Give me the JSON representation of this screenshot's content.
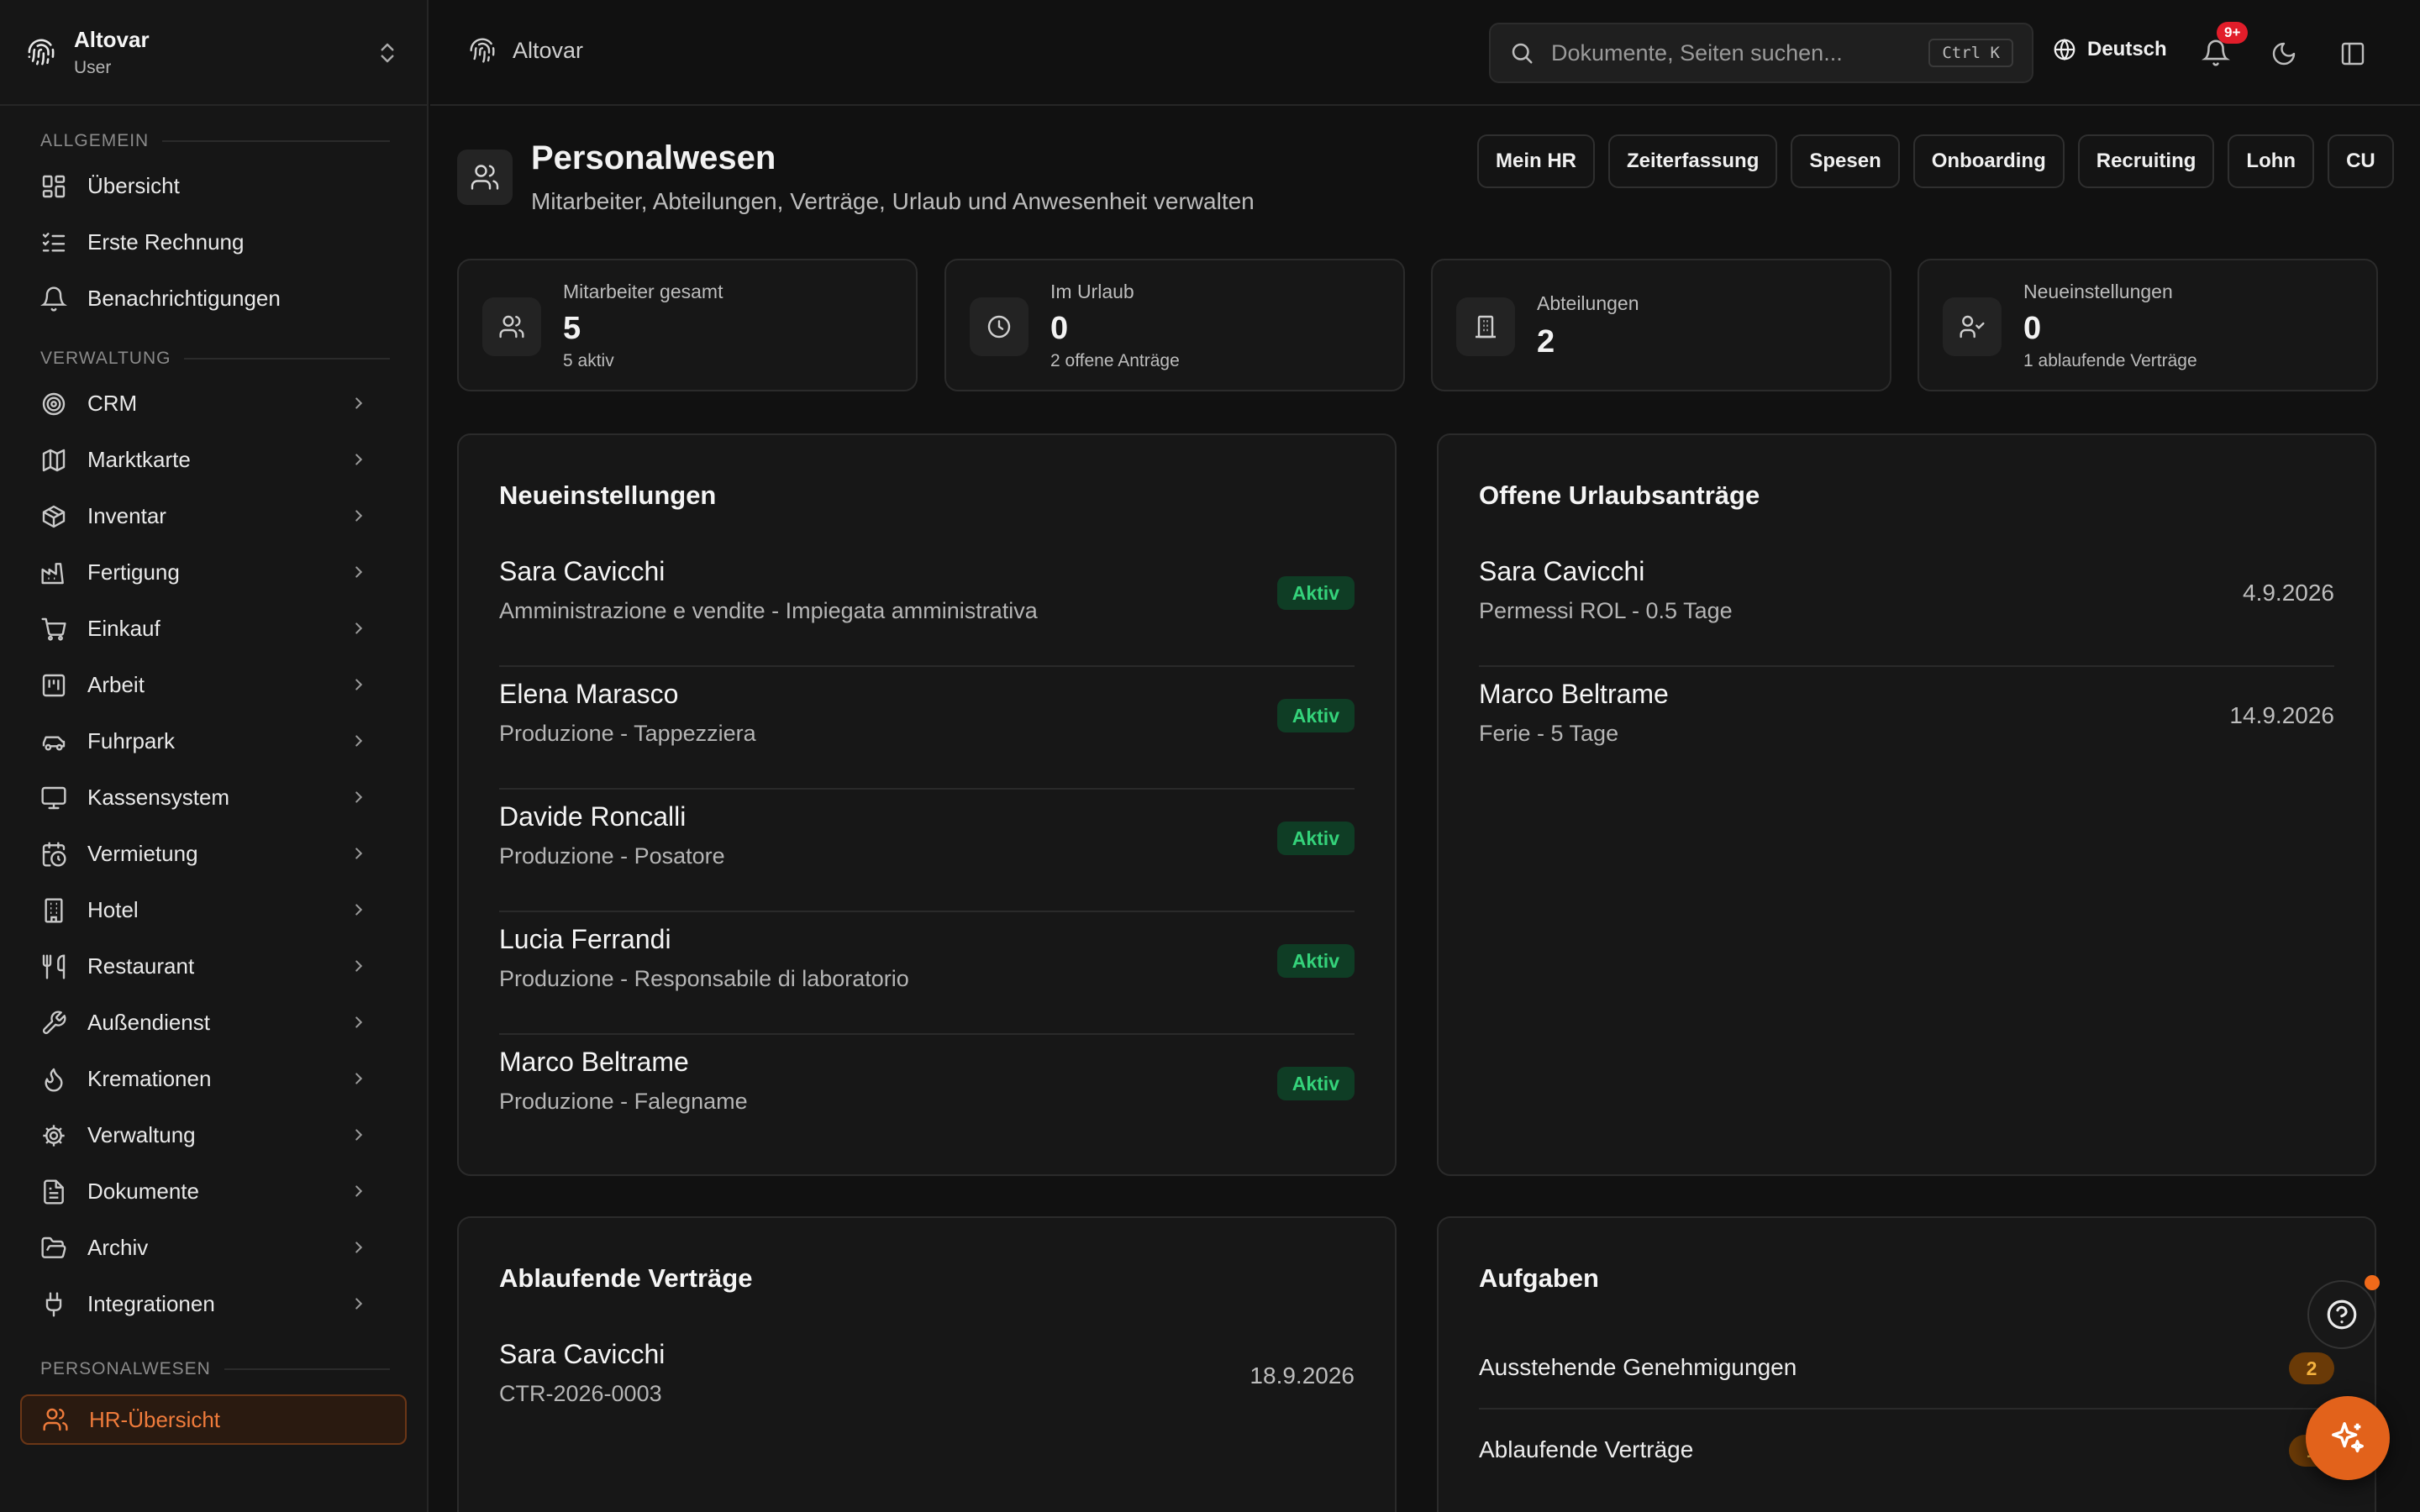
{
  "brand": {
    "name": "Altovar",
    "role": "User"
  },
  "sidebar": {
    "sections": {
      "general": "ALLGEMEIN",
      "admin": "VERWALTUNG",
      "hr": "PERSONALWESEN"
    },
    "general_items": [
      {
        "label": "Übersicht",
        "icon": "dashboard-icon"
      },
      {
        "label": "Erste Rechnung",
        "icon": "checklist-icon"
      },
      {
        "label": "Benachrichtigungen",
        "icon": "bell-icon"
      }
    ],
    "admin_items": [
      {
        "label": "CRM",
        "icon": "target-icon"
      },
      {
        "label": "Marktkarte",
        "icon": "map-icon"
      },
      {
        "label": "Inventar",
        "icon": "package-icon"
      },
      {
        "label": "Fertigung",
        "icon": "factory-icon"
      },
      {
        "label": "Einkauf",
        "icon": "cart-icon"
      },
      {
        "label": "Arbeit",
        "icon": "briefcase-icon"
      },
      {
        "label": "Fuhrpark",
        "icon": "car-icon"
      },
      {
        "label": "Kassensystem",
        "icon": "monitor-icon"
      },
      {
        "label": "Vermietung",
        "icon": "calendar-clock-icon"
      },
      {
        "label": "Hotel",
        "icon": "building-icon"
      },
      {
        "label": "Restaurant",
        "icon": "utensils-icon"
      },
      {
        "label": "Außendienst",
        "icon": "wrench-icon"
      },
      {
        "label": "Kremationen",
        "icon": "flame-icon"
      },
      {
        "label": "Verwaltung",
        "icon": "gear-icon"
      },
      {
        "label": "Dokumente",
        "icon": "file-icon"
      },
      {
        "label": "Archiv",
        "icon": "folder-open-icon"
      },
      {
        "label": "Integrationen",
        "icon": "plug-icon"
      }
    ],
    "hr_items": [
      {
        "label": "HR-Übersicht",
        "icon": "users-icon",
        "active": true
      }
    ]
  },
  "topbar": {
    "crumb": "Altovar",
    "search_placeholder": "Dokumente, Seiten suchen...",
    "search_shortcut": "Ctrl K",
    "language": "Deutsch",
    "notification_badge": "9+"
  },
  "page": {
    "title": "Personalwesen",
    "subtitle": "Mitarbeiter, Abteilungen, Verträge, Urlaub und Anwesenheit verwalten",
    "tabs": [
      "Mein HR",
      "Zeiterfassung",
      "Spesen",
      "Onboarding",
      "Recruiting",
      "Lohn",
      "CU"
    ]
  },
  "stats": [
    {
      "label": "Mitarbeiter gesamt",
      "value": "5",
      "sub": "5 aktiv",
      "icon": "users-icon"
    },
    {
      "label": "Im Urlaub",
      "value": "0",
      "sub": "2 offene Anträge",
      "icon": "clock-icon"
    },
    {
      "label": "Abteilungen",
      "value": "2",
      "sub": "",
      "icon": "building-icon"
    },
    {
      "label": "Neueinstellungen",
      "value": "0",
      "sub": "1 ablaufende Verträge",
      "icon": "user-check-icon"
    }
  ],
  "new_hires": {
    "title": "Neueinstellungen",
    "rows": [
      {
        "name": "Sara Cavicchi",
        "detail": "Amministrazione e vendite - Impiegata amministrativa",
        "status": "Aktiv"
      },
      {
        "name": "Elena Marasco",
        "detail": "Produzione - Tappezziera",
        "status": "Aktiv"
      },
      {
        "name": "Davide Roncalli",
        "detail": "Produzione - Posatore",
        "status": "Aktiv"
      },
      {
        "name": "Lucia Ferrandi",
        "detail": "Produzione - Responsabile di laboratorio",
        "status": "Aktiv"
      },
      {
        "name": "Marco Beltrame",
        "detail": "Produzione - Falegname",
        "status": "Aktiv"
      }
    ]
  },
  "leave_requests": {
    "title": "Offene Urlaubsanträge",
    "rows": [
      {
        "name": "Sara Cavicchi",
        "detail": "Permessi ROL - 0.5 Tage",
        "date": "4.9.2026"
      },
      {
        "name": "Marco Beltrame",
        "detail": "Ferie - 5 Tage",
        "date": "14.9.2026"
      }
    ]
  },
  "expiring_contracts": {
    "title": "Ablaufende Verträge",
    "rows": [
      {
        "name": "Sara Cavicchi",
        "detail": "CTR-2026-0003",
        "date": "18.9.2026"
      }
    ]
  },
  "tasks": {
    "title": "Aufgaben",
    "rows": [
      {
        "label": "Ausstehende Genehmigungen",
        "count": "2"
      },
      {
        "label": "Ablaufende Verträge",
        "count": "1"
      }
    ]
  },
  "colors": {
    "accent": "#e2621b",
    "status_active_bg": "#0f3d25",
    "status_active_fg": "#34d27a",
    "count_badge_bg": "#6a3a07",
    "count_badge_fg": "#f4b23e",
    "notification_badge": "#e11d2a"
  }
}
